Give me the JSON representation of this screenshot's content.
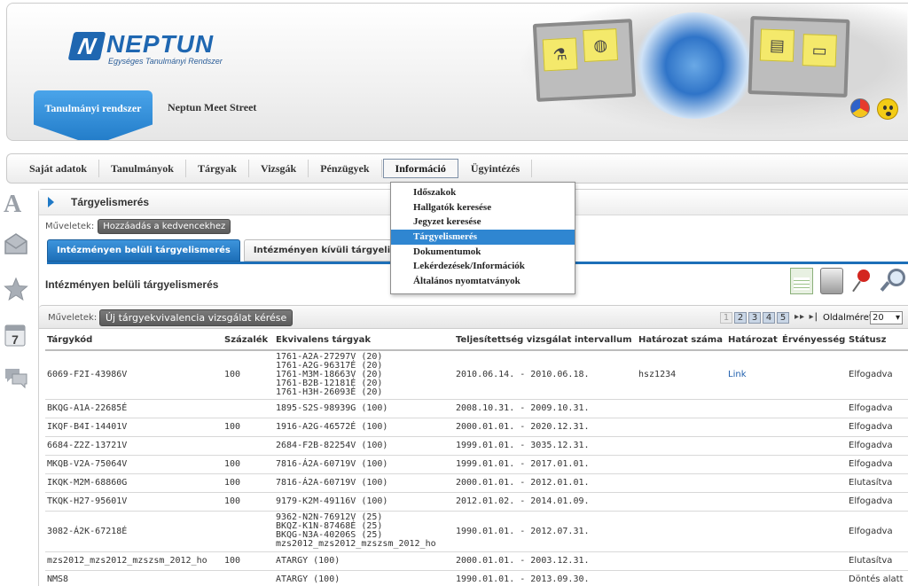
{
  "header": {
    "logo_text": "NEPTUN",
    "logo_mark": "N",
    "logo_subtitle": "Egységes Tanulmányi Rendszer",
    "system_tab": "Tanulmányi rendszer",
    "meet_street": "Neptun Meet Street",
    "icons": [
      "color-theme-icon",
      "smiley-icon"
    ]
  },
  "menu": {
    "items": [
      "Saját adatok",
      "Tanulmányok",
      "Tárgyak",
      "Vizsgák",
      "Pénzügyek",
      "Információ",
      "Ügyintézés"
    ],
    "active": "Információ"
  },
  "dropdown": {
    "items": [
      "Időszakok",
      "Hallgatók keresése",
      "Jegyzet keresése",
      "Tárgyelismerés",
      "Dokumentumok",
      "Lekérdezések/Információk",
      "Általános nyomtatványok"
    ],
    "highlighted": "Tárgyelismerés"
  },
  "sidebar": {
    "icons": [
      "font-size-icon",
      "mail-icon",
      "favorites-star-icon",
      "calendar-icon",
      "chat-icon"
    ],
    "calendar_day": "7",
    "font_letter": "A"
  },
  "page": {
    "title": "Tárgyelismerés",
    "ops_label": "Műveletek:",
    "add_favorite": "Hozzáadás a kedvencekhez",
    "subtabs": [
      "Intézményen belüli tárgyelismerés",
      "Intézményen kívüli tárgyelismerés"
    ],
    "section_title": "Intézményen belüli tárgyelismerés",
    "new_request": "Új tárgyekvivalencia vizsgálat kérése",
    "pager": [
      "1",
      "2",
      "3",
      "4",
      "5"
    ],
    "pager_current": "1",
    "pager_nav": "▸▸ ▸|",
    "page_size_label": "Oldalméret",
    "page_size": "20"
  },
  "table": {
    "columns": [
      "Tárgykód",
      "Százalék",
      "Ekvivalens tárgyak",
      "Teljesítettség vizsgálat intervallum",
      "Határozat száma",
      "Határozat",
      "Érvényesség",
      "Státusz"
    ],
    "rows": [
      {
        "code": "6069-F2I-43986V",
        "pct": "100",
        "equiv": [
          "1761-A2A-27297V (20)",
          "1761-A2G-96317É (20)",
          "1761-M3M-18663V (20)",
          "1761-B2B-12181É (20)",
          "1761-H3H-26093É (20)"
        ],
        "interval": "2010.06.14. - 2010.06.18.",
        "decision_no": "hsz1234",
        "decision": "Link",
        "validity": "",
        "status": "Elfogadva"
      },
      {
        "code": "BKQG-A1A-22685É",
        "pct": "",
        "equiv": [
          "1895-S2S-98939G (100)"
        ],
        "interval": "2008.10.31. - 2009.10.31.",
        "decision_no": "",
        "decision": "",
        "validity": "",
        "status": "Elfogadva"
      },
      {
        "code": "IKQF-B4I-14401V",
        "pct": "100",
        "equiv": [
          "1916-A2G-46572É (100)"
        ],
        "interval": "2000.01.01. - 2020.12.31.",
        "decision_no": "",
        "decision": "",
        "validity": "",
        "status": "Elfogadva"
      },
      {
        "code": "6684-Z2Z-13721V",
        "pct": "",
        "equiv": [
          "2684-F2B-82254V (100)"
        ],
        "interval": "1999.01.01. - 3035.12.31.",
        "decision_no": "",
        "decision": "",
        "validity": "",
        "status": "Elfogadva"
      },
      {
        "code": "MKQB-V2A-75064V",
        "pct": "100",
        "equiv": [
          "7816-Á2A-60719V (100)"
        ],
        "interval": "1999.01.01. - 2017.01.01.",
        "decision_no": "",
        "decision": "",
        "validity": "",
        "status": "Elfogadva"
      },
      {
        "code": "IKQK-M2M-68860G",
        "pct": "100",
        "equiv": [
          "7816-Á2A-60719V (100)"
        ],
        "interval": "2000.01.01. - 2012.01.01.",
        "decision_no": "",
        "decision": "",
        "validity": "",
        "status": "Elutasítva"
      },
      {
        "code": "TKQK-H27-95601V",
        "pct": "100",
        "equiv": [
          "9179-K2M-49116V (100)"
        ],
        "interval": "2012.01.02. - 2014.01.09.",
        "decision_no": "",
        "decision": "",
        "validity": "",
        "status": "Elfogadva"
      },
      {
        "code": "3082-Á2K-67218É",
        "pct": "",
        "equiv": [
          "9362-N2N-76912V (25)",
          "BKQZ-K1N-87468É (25)",
          "BKQG-N3A-40206S (25)",
          "mzs2012_mzs2012_mzszsm_2012_ho"
        ],
        "interval": "1990.01.01. - 2012.07.31.",
        "decision_no": "",
        "decision": "",
        "validity": "",
        "status": "Elfogadva"
      },
      {
        "code": "mzs2012_mzs2012_mzszsm_2012_ho",
        "pct": "100",
        "equiv": [
          "ATARGY (100)"
        ],
        "interval": "2000.01.01. - 2003.12.31.",
        "decision_no": "",
        "decision": "",
        "validity": "",
        "status": "Elutasítva"
      },
      {
        "code": "NMS8",
        "pct": "",
        "equiv": [
          "ATARGY (100)"
        ],
        "interval": "1990.01.01. - 2013.09.30.",
        "decision_no": "",
        "decision": "",
        "validity": "",
        "status": "Döntés alatt"
      }
    ]
  },
  "tools": [
    "excel-export-icon",
    "print-icon",
    "pin-icon",
    "search-zoom-icon"
  ]
}
